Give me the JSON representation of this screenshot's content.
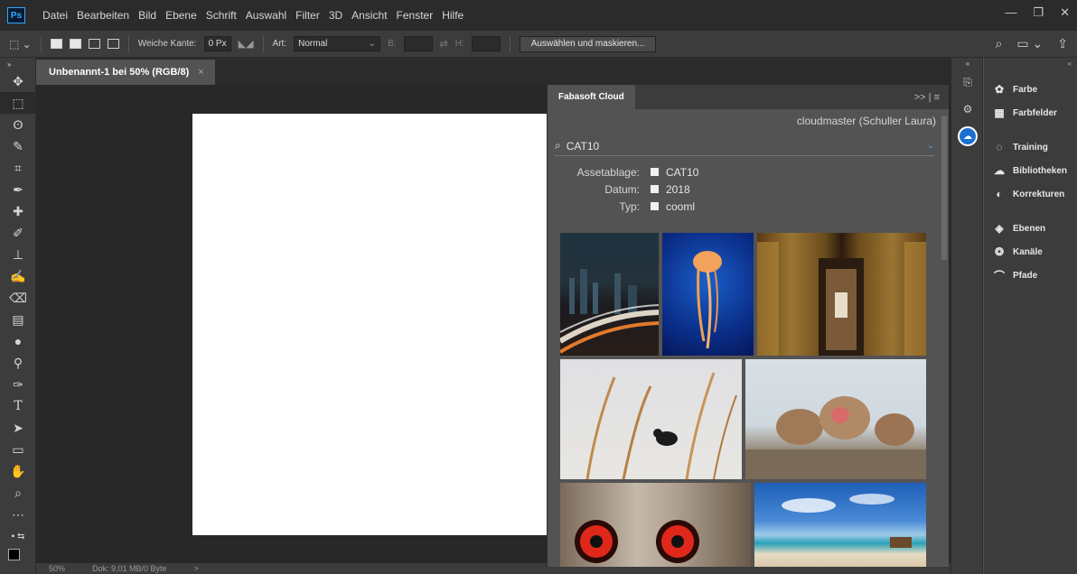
{
  "menubar": {
    "app_icon": "Ps",
    "items": [
      "Datei",
      "Bearbeiten",
      "Bild",
      "Ebene",
      "Schrift",
      "Auswahl",
      "Filter",
      "3D",
      "Ansicht",
      "Fenster",
      "Hilfe"
    ]
  },
  "options": {
    "feather_label": "Weiche Kante:",
    "feather_value": "0 Px",
    "style_label": "Art:",
    "style_value": "Normal",
    "width_label": "B:",
    "height_label": "H:",
    "select_mask_button": "Auswählen und maskieren..."
  },
  "document": {
    "tab_title": "Unbenannt-1 bei 50% (RGB/8)",
    "close_glyph": "×"
  },
  "status": {
    "zoom": "50%",
    "doc_info": "Dok: 9,01 MB/0 Byte",
    "arrow": ">"
  },
  "fabasoft": {
    "tab_title": "Fabasoft Cloud",
    "menu_glyph": ">> | ≡",
    "user": "cloudmaster (Schuller Laura)",
    "search_value": "CAT10",
    "filters": [
      {
        "key": "Assetablage:",
        "value": "CAT10"
      },
      {
        "key": "Datum:",
        "value": "2018"
      },
      {
        "key": "Typ:",
        "value": "cooml"
      }
    ]
  },
  "right_panel": {
    "items": [
      {
        "label": "Farbe",
        "icon": "palette-icon"
      },
      {
        "label": "Farbfelder",
        "icon": "swatches-icon"
      },
      {
        "label": "Training",
        "icon": "lightbulb-icon"
      },
      {
        "label": "Bibliotheken",
        "icon": "libraries-icon"
      },
      {
        "label": "Korrekturen",
        "icon": "adjustments-icon"
      },
      {
        "label": "Ebenen",
        "icon": "layers-icon"
      },
      {
        "label": "Kanäle",
        "icon": "channels-icon"
      },
      {
        "label": "Pfade",
        "icon": "paths-icon"
      }
    ]
  },
  "colors": {
    "accent": "#31a8ff",
    "dark_bg": "#2b2b2b",
    "panel_bg": "#3c3c3c",
    "mid_bg": "#535353"
  }
}
